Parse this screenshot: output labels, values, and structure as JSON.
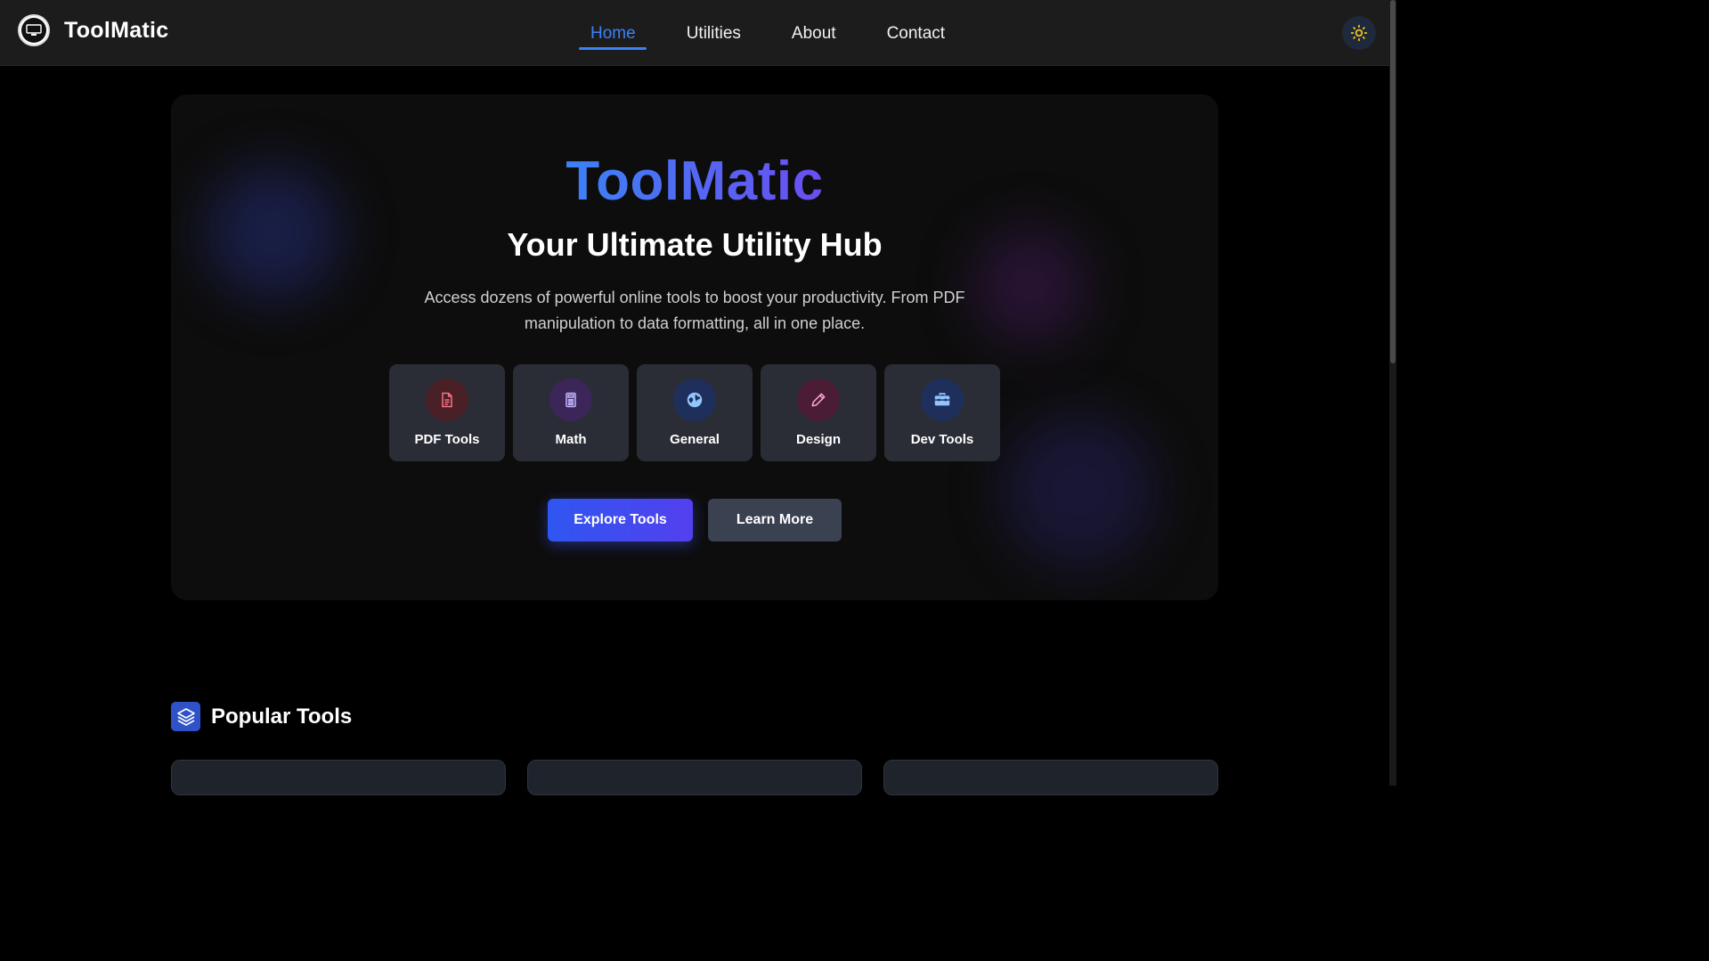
{
  "header": {
    "brand": "ToolMatic",
    "nav": [
      {
        "label": "Home",
        "active": true
      },
      {
        "label": "Utilities"
      },
      {
        "label": "About"
      },
      {
        "label": "Contact"
      }
    ],
    "theme_icon": "sun-icon"
  },
  "hero": {
    "title": "ToolMatic",
    "subtitle": "Your Ultimate Utility Hub",
    "description": "Access dozens of powerful online tools to boost your productivity. From PDF manipulation to data formatting, all in one place.",
    "categories": [
      {
        "label": "PDF Tools",
        "icon": "document-icon",
        "color": "#fb7185",
        "bg": "#4a2027"
      },
      {
        "label": "Math",
        "icon": "calculator-icon",
        "color": "#c4b5fd",
        "bg": "#3b2559"
      },
      {
        "label": "General",
        "icon": "globe-icon",
        "color": "#93c5fd",
        "bg": "#1e2f5c"
      },
      {
        "label": "Design",
        "icon": "pencil-icon",
        "color": "#f9a8d4",
        "bg": "#4a1d35"
      },
      {
        "label": "Dev Tools",
        "icon": "toolbox-icon",
        "color": "#93c5fd",
        "bg": "#1e2f5c"
      }
    ],
    "primary_button": "Explore Tools",
    "secondary_button": "Learn More"
  },
  "popular": {
    "title": "Popular Tools",
    "icon": "layers-icon"
  }
}
